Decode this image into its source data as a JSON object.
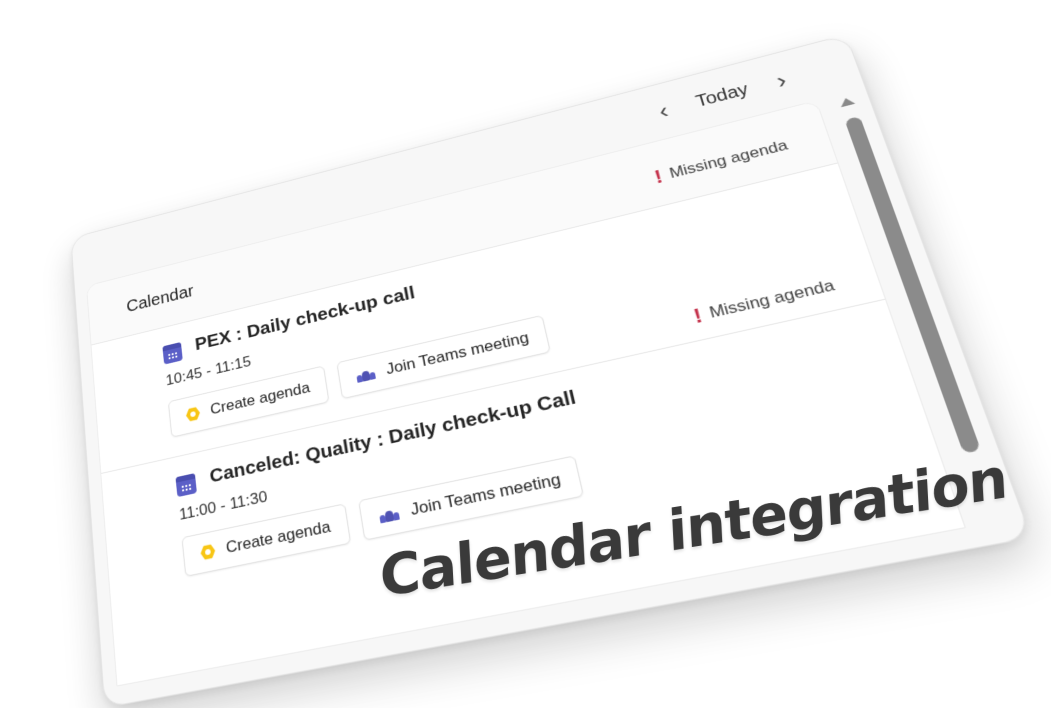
{
  "nav": {
    "prev_icon": "chevron-left-icon",
    "label": "Today",
    "next_icon": "chevron-right-icon",
    "prev_glyph": "‹",
    "next_glyph": "›"
  },
  "panel": {
    "title": "Calendar"
  },
  "events": [
    {
      "title": "PEX : Daily check-up call",
      "time": "10:45 - 11:15",
      "status": "Missing agenda",
      "create_label": "Create agenda",
      "join_label": "Join Teams meeting"
    },
    {
      "title": "Canceled: Quality : Daily check-up Call",
      "time": "11:00 - 11:30",
      "status": "Missing agenda",
      "create_label": "Create agenda",
      "join_label": "Join Teams meeting"
    }
  ],
  "status_glyph": "!",
  "caption": "Calendar integration",
  "colors": {
    "accent": "#5b5fc7",
    "warning": "#c4314b",
    "agenda_icon": "#f8c615",
    "caption": "#3a3a3a"
  }
}
